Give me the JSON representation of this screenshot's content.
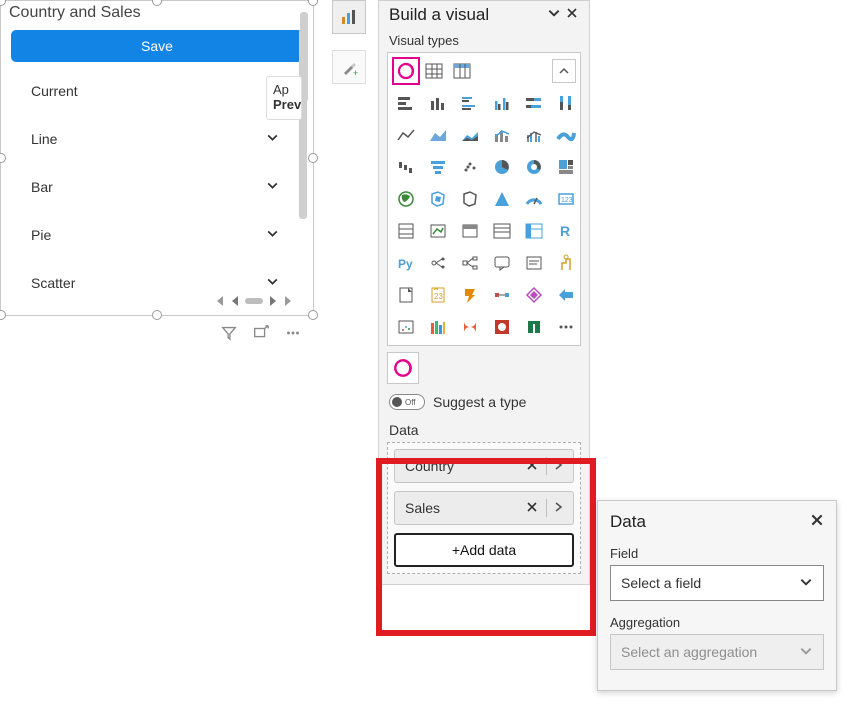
{
  "tile": {
    "title": "Country and Sales",
    "save_label": "Save",
    "sections": [
      "Current",
      "Line",
      "Bar",
      "Pie",
      "Scatter"
    ],
    "apply_line1": "Ap",
    "apply_line2": "Previ"
  },
  "panel": {
    "title": "Build a visual",
    "visual_types_label": "Visual types",
    "suggest_label": "Suggest a type",
    "toggle_state": "Off",
    "data_label": "Data",
    "fields": [
      "Country",
      "Sales"
    ],
    "add_data_label": "+Add data"
  },
  "flyout": {
    "title": "Data",
    "field_label": "Field",
    "field_placeholder": "Select a field",
    "aggregation_label": "Aggregation",
    "aggregation_placeholder": "Select an aggregation"
  }
}
